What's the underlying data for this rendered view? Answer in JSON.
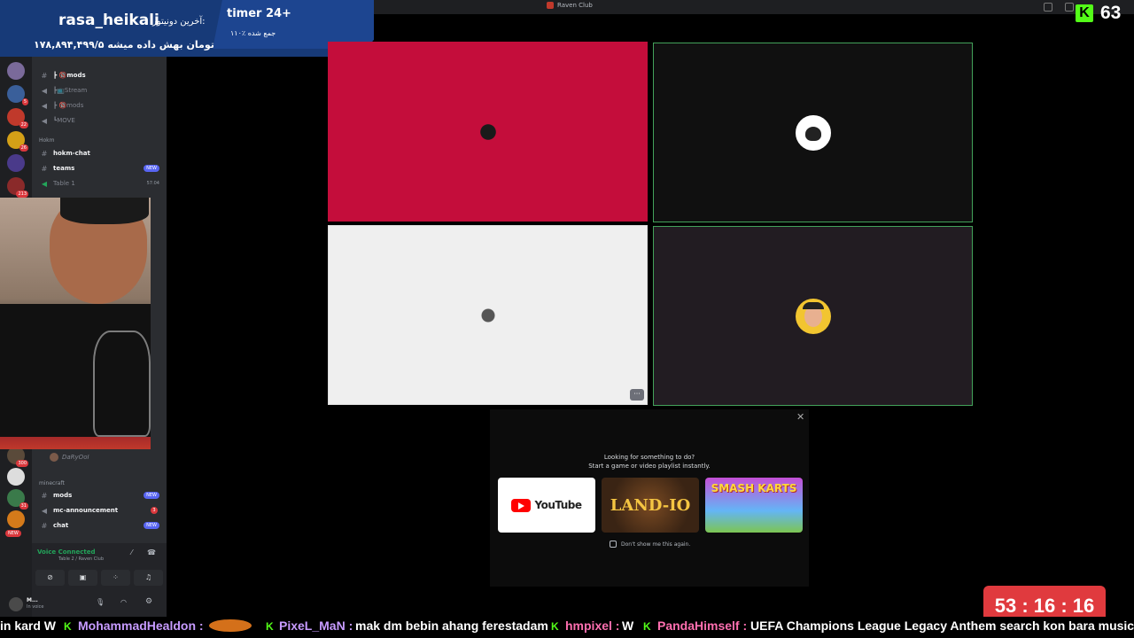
{
  "app": {
    "title": "Raven Club"
  },
  "donor": {
    "label": "آخرین دونیتور:",
    "name": "rasa_heikali",
    "amount_text": "۱۷۸,۸۹۴,۴۹۹/۵ تومان بهش داده میشه",
    "timer_label": "timer 24+",
    "timer_sub": "۱۱۰٪ جمع شده"
  },
  "stream": {
    "viewer_count": "63",
    "countdown": "53 : 16 : 16"
  },
  "sidebar": {
    "channels_top": [
      {
        "label": "┣ 🔞mods",
        "type": "text"
      },
      {
        "label": "┣📺Stream",
        "type": "voice"
      },
      {
        "label": "┣ 🔞mods",
        "type": "voice"
      },
      {
        "label": "┗MOVE",
        "type": "voice"
      }
    ],
    "category_hokm": "Hokm",
    "hokm_channels": [
      {
        "label": "hokm-chat",
        "badge": ""
      },
      {
        "label": "teams",
        "badge": "NEW"
      },
      {
        "label": "Table 1",
        "badge": "57:04"
      }
    ],
    "voice_user": "DaRyOoI",
    "category_minecraft": "minecraft",
    "mc_channels": [
      {
        "label": "mods",
        "badge": "NEW"
      },
      {
        "label": "mc-announcement",
        "badge": "3"
      },
      {
        "label": "chat",
        "badge": "NEW"
      }
    ],
    "new_pill": "NEW"
  },
  "voice_status": {
    "connected": "Voice Connected",
    "location": "Table 2 / Raven Club"
  },
  "user_panel": {
    "name": "M...",
    "status": "In voice"
  },
  "activity": {
    "line1": "Looking for something to do?",
    "line2": "Start a game or video playlist instantly.",
    "youtube": "YouTube",
    "landio": "LAND-IO",
    "smash": "SMASH KARTS",
    "dont_show": "Don't show me this again."
  },
  "ticker": {
    "items": [
      {
        "user": "in kard W",
        "msg": ""
      },
      {
        "user": "MohammadHealdon :",
        "msg": ""
      },
      {
        "user": "PixeL_MaN :",
        "msg": "mak dm bebin ahang ferestadam"
      },
      {
        "user": "hmpixel :",
        "msg": "W"
      },
      {
        "user": "PandaHimself :",
        "msg": "UEFA Champions League Legacy Anthem search kon bara music XD"
      }
    ]
  },
  "colors": {
    "accent_green": "#53fc18",
    "discord_blurple": "#5865f2",
    "tile_red": "#c40d3b",
    "speaking_green": "#43a25a",
    "timer_red": "#e03a3e"
  }
}
